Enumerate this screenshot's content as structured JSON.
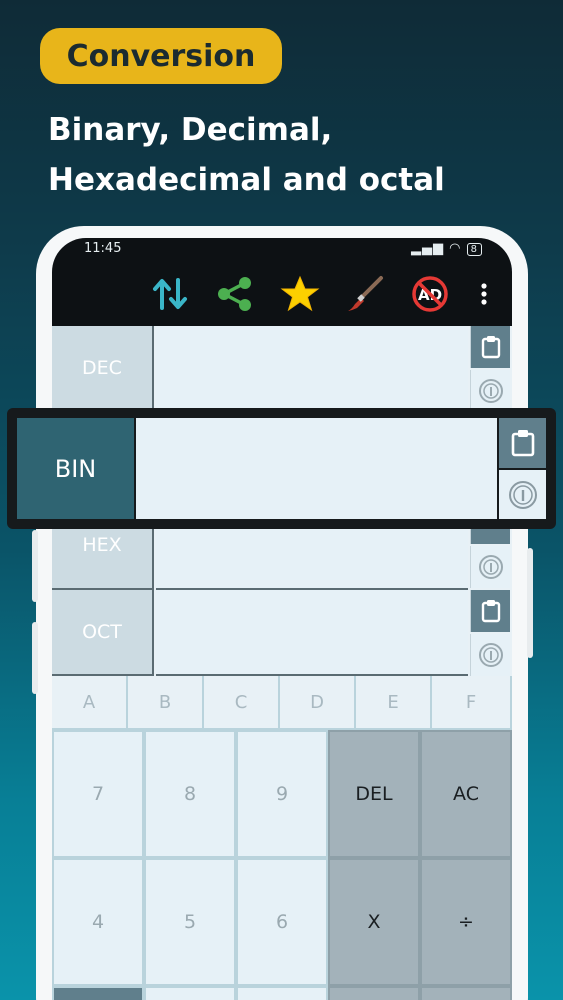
{
  "promo": {
    "badge": "Conversion",
    "headline_line1": "Binary, Decimal,",
    "headline_line2": "Hexadecimal and octal"
  },
  "status_bar": {
    "time": "11:45",
    "battery": "8"
  },
  "toolbar": {
    "icons": [
      "swap-arrows-icon",
      "share-icon",
      "star-icon",
      "brush-icon",
      "no-ads-icon",
      "more-vert-icon"
    ],
    "no_ads_text": "AD"
  },
  "bases": [
    {
      "label": "DEC",
      "value": ""
    },
    {
      "label": "BIN",
      "value": ""
    },
    {
      "label": "HEX",
      "value": ""
    },
    {
      "label": "OCT",
      "value": ""
    }
  ],
  "hex_keys": [
    "A",
    "B",
    "C",
    "D",
    "E",
    "F"
  ],
  "keypad": {
    "row1": [
      "7",
      "8",
      "9",
      "DEL",
      "AC"
    ],
    "row2": [
      "4",
      "5",
      "6",
      "X",
      "÷"
    ]
  },
  "colors": {
    "badge": "#e8b51a",
    "accent_teal": "#2f6472",
    "toolbar_bg": "#0d1114"
  }
}
